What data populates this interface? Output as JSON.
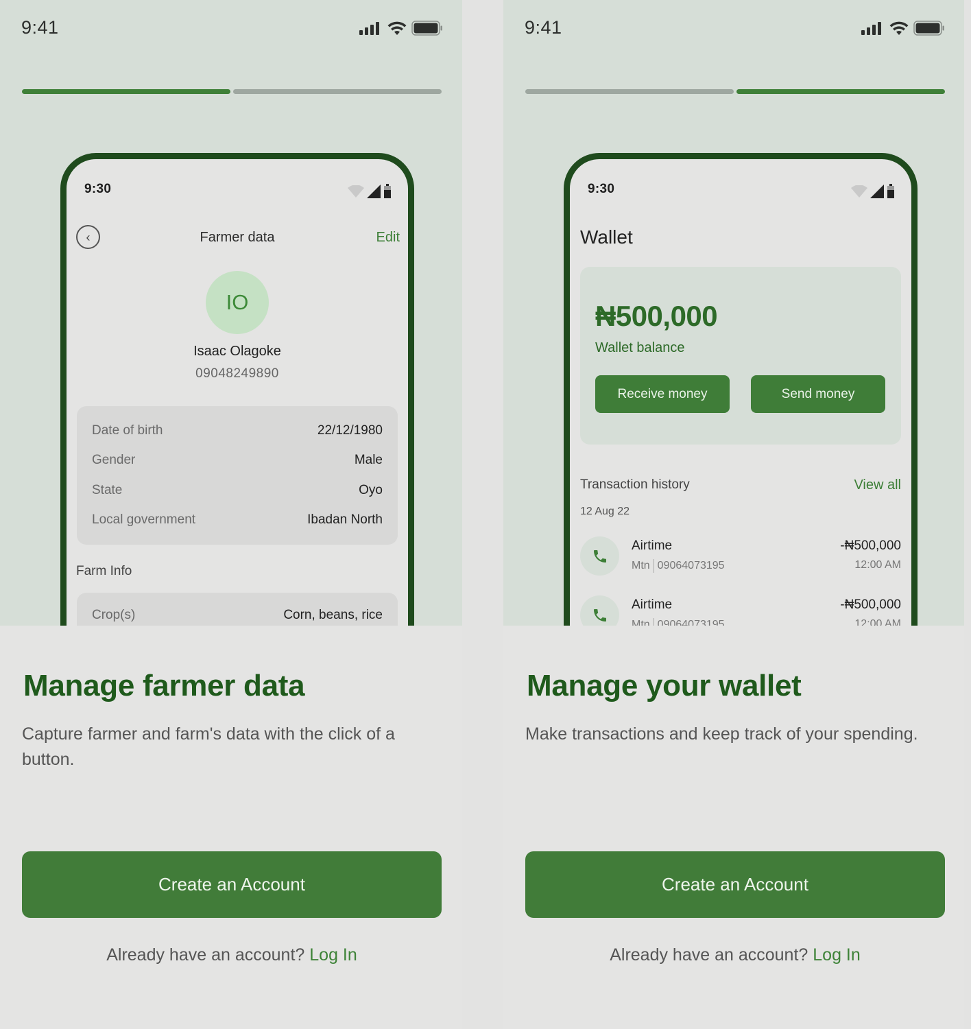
{
  "colors": {
    "brand_green": "#417c39",
    "dark_green": "#1f5a1c",
    "accent_light_green": "#c5e1c4",
    "progress_inactive": "#9ea7a0",
    "hero_bg": "#d6ded7"
  },
  "screens": [
    {
      "status_time": "9:41",
      "progress": {
        "active_step": 1,
        "total_steps": 2
      },
      "phone": {
        "time": "9:30",
        "title": "Farmer data",
        "edit_label": "Edit",
        "avatar_initials": "IO",
        "name": "Isaac Olagoke",
        "phone": "09048249890",
        "details": [
          {
            "label": "Date of birth",
            "value": "22/12/1980"
          },
          {
            "label": "Gender",
            "value": "Male"
          },
          {
            "label": "State",
            "value": "Oyo"
          },
          {
            "label": "Local government",
            "value": "Ibadan North"
          }
        ],
        "farm_info_label": "Farm Info",
        "farm_info": [
          {
            "label": "Crop(s)",
            "value": "Corn, beans, rice"
          }
        ]
      },
      "heading": "Manage farmer data",
      "description": "Capture farmer and farm's data with the click of a button.",
      "cta_label": "Create an Account",
      "login_prompt": "Already have an account?",
      "login_link": "Log In"
    },
    {
      "status_time": "9:41",
      "progress": {
        "active_step": 2,
        "total_steps": 2
      },
      "phone": {
        "time": "9:30",
        "title": "Wallet",
        "balance": "₦500,000",
        "balance_label": "Wallet balance",
        "receive_label": "Receive money",
        "send_label": "Send money",
        "history_label": "Transaction history",
        "view_all_label": "View all",
        "date_group": "12 Aug 22",
        "transactions": [
          {
            "name": "Airtime",
            "provider": "Mtn",
            "number": "09064073195",
            "amount": "-₦500,000",
            "time": "12:00 AM"
          },
          {
            "name": "Airtime",
            "provider": "Mtn",
            "number": "09064073195",
            "amount": "-₦500,000",
            "time": "12:00 AM"
          }
        ]
      },
      "heading": "Manage your wallet",
      "description": "Make transactions and keep track of your spending.",
      "cta_label": "Create an Account",
      "login_prompt": "Already have an account?",
      "login_link": "Log In"
    }
  ]
}
